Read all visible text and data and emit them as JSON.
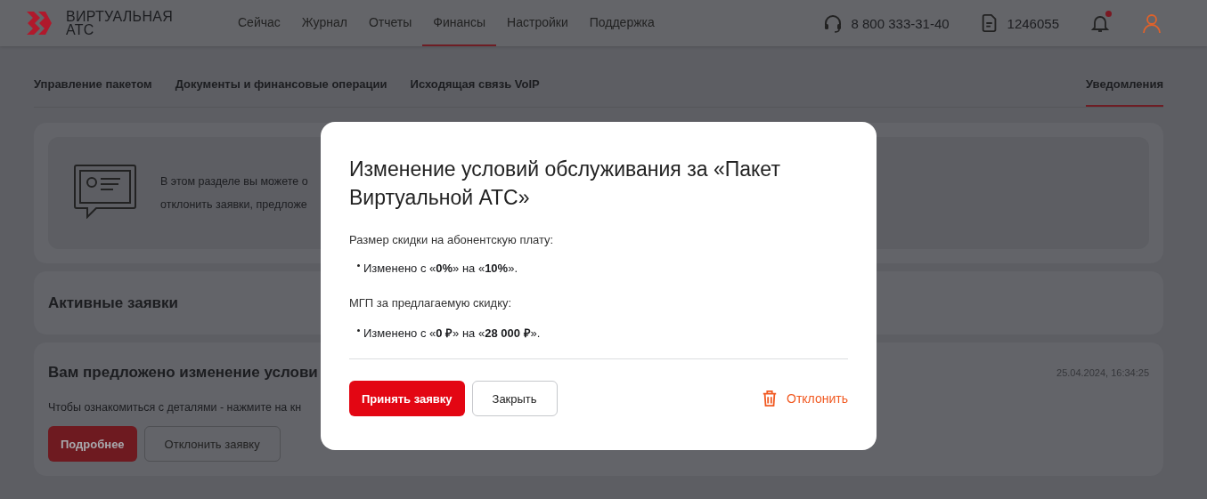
{
  "header": {
    "logo": {
      "line_1": "ВИРТУАЛЬНАЯ",
      "line_2": "АТС"
    },
    "nav": [
      {
        "label": "Сейчас",
        "selected": false
      },
      {
        "label": "Журнал",
        "selected": false
      },
      {
        "label": "Отчеты",
        "selected": false
      },
      {
        "label": "Финансы",
        "selected": true
      },
      {
        "label": "Настройки",
        "selected": false
      },
      {
        "label": "Поддержка",
        "selected": false
      }
    ],
    "phone": "8 800 333-31-40",
    "account": "1246055",
    "notifications": {
      "unread": true
    }
  },
  "subtabs": [
    {
      "label": "Управление пакетом",
      "selected": false
    },
    {
      "label": "Документы и финансовые операции",
      "selected": false
    },
    {
      "label": "Исходящая связь VoIP",
      "selected": false
    },
    {
      "label": "Уведомления",
      "selected": true
    }
  ],
  "intro": {
    "line_1": "В этом разделе вы можете о",
    "line_2": "отклонить заявки, предложе"
  },
  "active_requests": {
    "title": "Активные заявки"
  },
  "request": {
    "title": "Вам предложено изменение услови",
    "timestamp": "25.04.2024, 16:34:25",
    "hint": "Чтобы ознакомиться с деталями - нажмите на кн",
    "buttons": [
      {
        "label": "Подробнее",
        "kind": "primary"
      },
      {
        "label": "Отклонить заявку",
        "kind": "secondary"
      }
    ]
  },
  "dialog": {
    "title": "Изменение условий обслуживания за «Пакет Виртуальной АТС»",
    "sections": [
      {
        "label": "Размер скидки на абонентскую плату:",
        "change": "Изменено с «**0%**» на «**10%**»."
      },
      {
        "label": "МГП за предлагаемую скидку:",
        "change": "Изменено с «**0 ₽**» на «**28 000 ₽**»."
      }
    ],
    "buttons": [
      {
        "label": "Принять заявку",
        "kind": "primary"
      },
      {
        "label": "Закрыть",
        "kind": "secondary"
      }
    ],
    "decline": "Отклонить"
  }
}
